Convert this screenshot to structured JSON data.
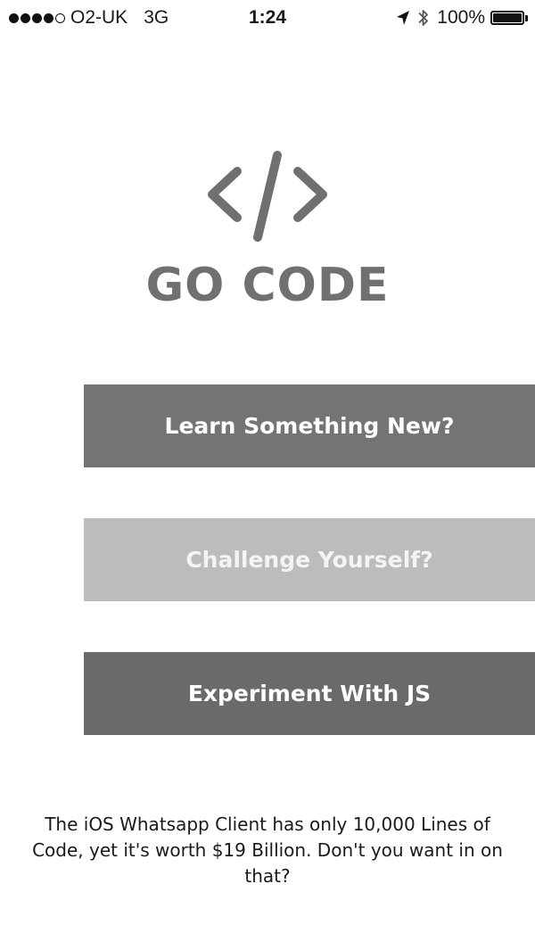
{
  "status_bar": {
    "carrier": "O2-UK",
    "network": "3G",
    "time": "1:24",
    "battery_percent": "100%",
    "battery_level": 1.0,
    "signal_bars_filled": 4,
    "signal_bars_total": 5,
    "icons": [
      "location-arrow-icon",
      "bluetooth-icon",
      "battery-icon"
    ]
  },
  "logo": {
    "icon": "code-brackets-icon",
    "title": "GO CODE"
  },
  "menu": {
    "learn_label": "Learn Something New?",
    "challenge_label": "Challenge Yourself?",
    "experiment_label": "Experiment With JS"
  },
  "footer": {
    "text": "The iOS Whatsapp Client has only 10,000 Lines of Code, yet it's worth $19 Billion. Don't you want in on that?"
  },
  "colors": {
    "logo_gray": "#707070",
    "learn_button": "#747474",
    "challenge_button": "#bcbcbc",
    "experiment_button": "#6a6a6a"
  }
}
